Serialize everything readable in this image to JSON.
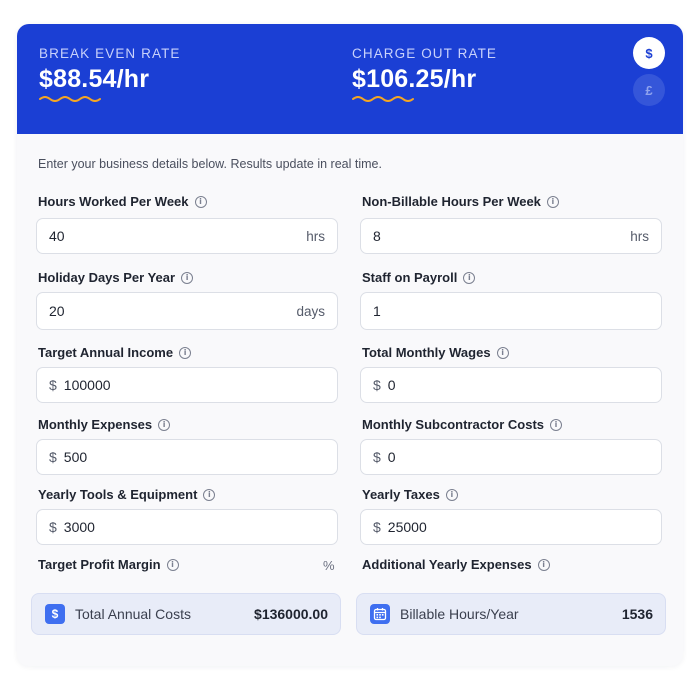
{
  "header": {
    "break_even": {
      "label": "BREAK EVEN RATE",
      "value": "$88.54/hr"
    },
    "charge_out": {
      "label": "CHARGE OUT RATE",
      "value": "$106.25/hr"
    },
    "currency_usd": "$",
    "currency_gbp": "£",
    "accent_color": "#1b3fd4",
    "underline_color": "#f5a623"
  },
  "intro": "Enter your business details below. Results update in real time.",
  "fields": {
    "hours_worked": {
      "label": "Hours Worked Per Week",
      "value": "40",
      "suffix": "hrs"
    },
    "non_billable": {
      "label": "Non-Billable Hours Per Week",
      "value": "8",
      "suffix": "hrs"
    },
    "holiday_days": {
      "label": "Holiday Days Per Year",
      "value": "20",
      "suffix": "days"
    },
    "staff": {
      "label": "Staff on Payroll",
      "value": "1"
    },
    "target_income": {
      "label": "Target Annual Income",
      "prefix": "$",
      "value": "100000"
    },
    "monthly_wages": {
      "label": "Total Monthly Wages",
      "prefix": "$",
      "value": "0"
    },
    "monthly_expenses": {
      "label": "Monthly Expenses",
      "prefix": "$",
      "value": "500"
    },
    "subcontractor": {
      "label": "Monthly Subcontractor Costs",
      "prefix": "$",
      "value": "0"
    },
    "tools": {
      "label": "Yearly Tools & Equipment",
      "prefix": "$",
      "value": "3000"
    },
    "taxes": {
      "label": "Yearly Taxes",
      "prefix": "$",
      "value": "25000"
    },
    "profit_margin": {
      "label": "Target Profit Margin",
      "suffix": "%"
    },
    "additional": {
      "label": "Additional Yearly Expenses"
    }
  },
  "summary": {
    "total_costs": {
      "label": "Total Annual Costs",
      "value": "$136000.00",
      "icon": "dollar-icon"
    },
    "billable_hours": {
      "label": "Billable Hours/Year",
      "value": "1536",
      "icon": "calendar-icon"
    }
  },
  "info_glyph": "i"
}
